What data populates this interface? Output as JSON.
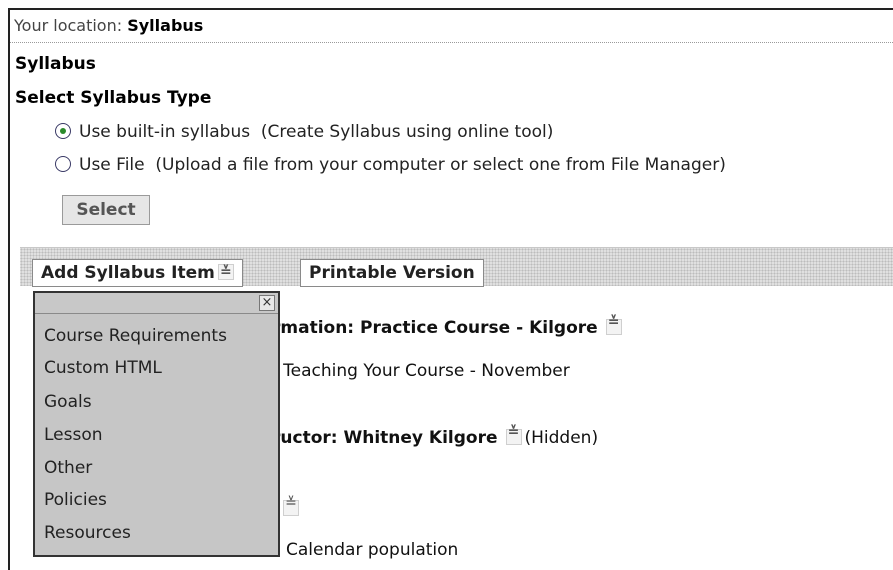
{
  "location": {
    "prefix": "Your location:",
    "current": "Syllabus"
  },
  "page_title": "Syllabus",
  "section_title": "Select Syllabus Type",
  "options": [
    {
      "label": "Use built-in syllabus",
      "description": "(Create Syllabus using online tool)",
      "selected": true
    },
    {
      "label": "Use File",
      "description": "(Upload a file from your computer or select one from File Manager)",
      "selected": false
    }
  ],
  "select_button": "Select",
  "toolbar": {
    "add_item": "Add Syllabus Item",
    "printable": "Printable Version"
  },
  "dropdown": {
    "close": "×",
    "items": [
      "Course Requirements",
      "Custom HTML",
      "Goals",
      "Lesson",
      "Other",
      "Policies",
      "Resources"
    ]
  },
  "content": {
    "course_info": "rmation: Practice Course - Kilgore",
    "course_sub": ": Teaching Your Course - November",
    "instructor": "ructor: Whitney Kilgore",
    "hidden_tag": "(Hidden)",
    "bottom_partial": "Calendar population"
  },
  "colors": {
    "toolbar_bg": "#e0e0e0",
    "dropdown_bg": "#c6c6c6",
    "radio_accent": "#2a8a2a"
  }
}
